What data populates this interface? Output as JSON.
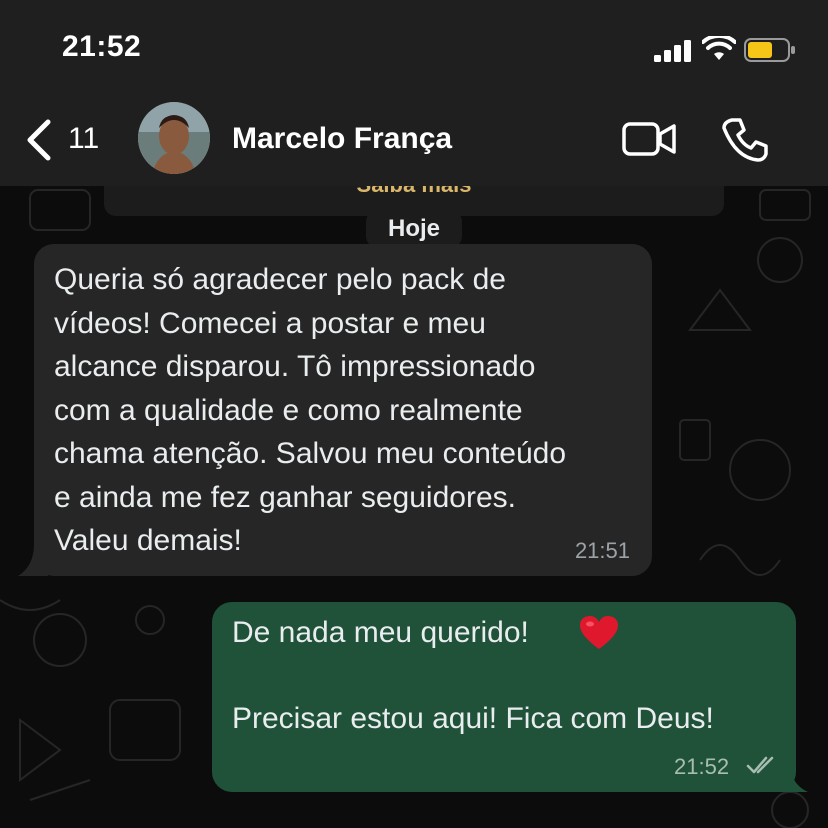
{
  "status_bar": {
    "time": "21:52"
  },
  "header": {
    "back_count": "11",
    "contact_name": "Marcelo França"
  },
  "system_card": {
    "link_label": "Saiba mais"
  },
  "date_divider": "Hoje",
  "messages": [
    {
      "direction": "incoming",
      "text": "Queria só agradecer pelo pack de\nvídeos! Comecei a postar e meu\nalcance disparou. Tô impressionado\ncom a qualidade e como realmente\nchama atenção. Salvou meu conteúdo\ne ainda me fez ganhar seguidores.\nValeu demais!",
      "time": "21:51"
    },
    {
      "direction": "outgoing",
      "line1": "De nada meu querido!",
      "emoji": "heart",
      "line2": "Precisar estou aqui! Fica com Deus!",
      "time": "21:52",
      "status": "read"
    }
  ],
  "colors": {
    "incoming_bubble": "#262626",
    "outgoing_bubble": "#1f5239",
    "header_bg": "#1f1f1f",
    "battery_fill": "#f5c518"
  }
}
